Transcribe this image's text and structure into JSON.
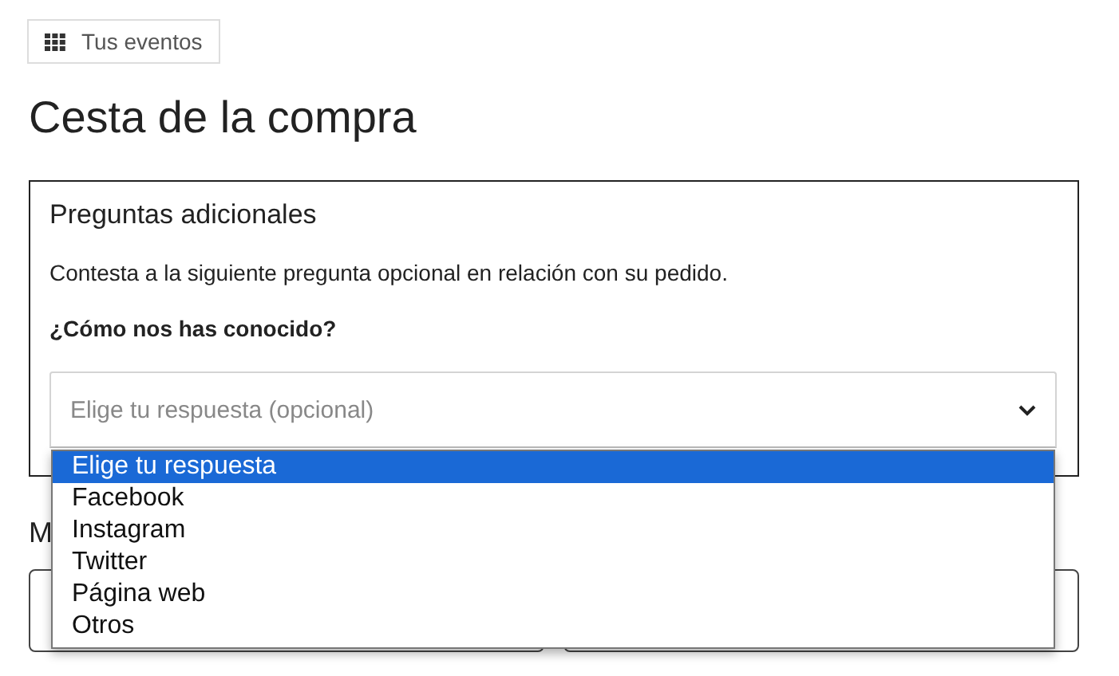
{
  "nav_button": {
    "label": "Tus eventos"
  },
  "title": "Cesta de la compra",
  "panel": {
    "title": "Preguntas adicionales",
    "description": "Contesta a la siguiente pregunta opcional en relación con su pedido.",
    "question": "¿Cómo nos has conocido?",
    "select": {
      "placeholder": "Elige tu respuesta (opcional)",
      "expanded": true,
      "options": [
        {
          "label": "Elige tu respuesta",
          "selected": true
        },
        {
          "label": "Facebook",
          "selected": false
        },
        {
          "label": "Instagram",
          "selected": false
        },
        {
          "label": "Twitter",
          "selected": false
        },
        {
          "label": "Página web",
          "selected": false
        },
        {
          "label": "Otros",
          "selected": false
        }
      ]
    }
  },
  "next_section": {
    "heading": "M"
  }
}
